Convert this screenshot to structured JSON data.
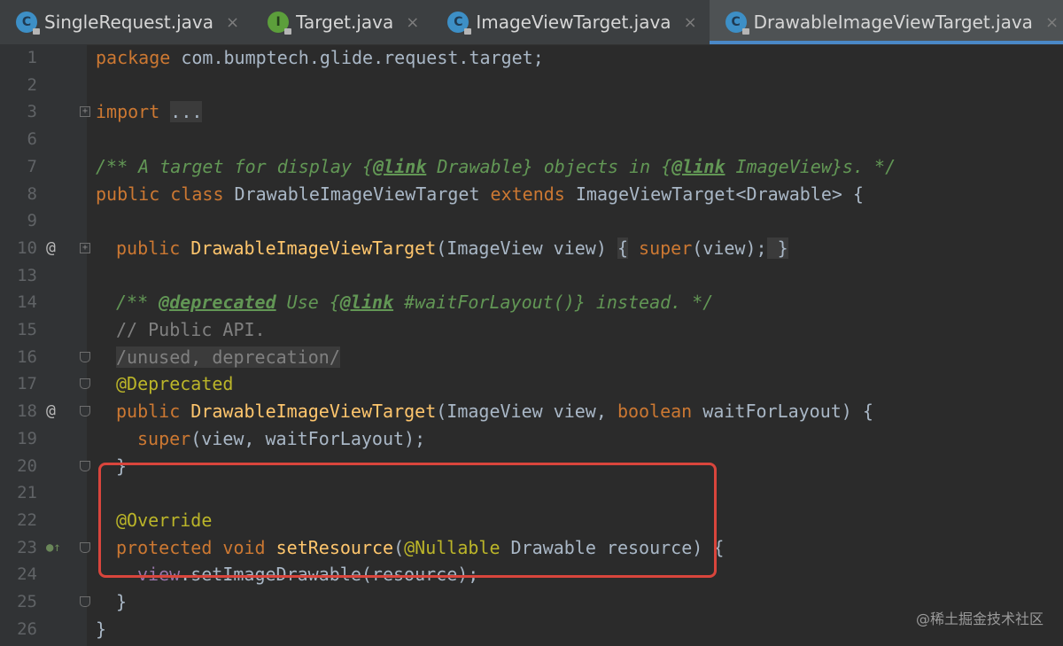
{
  "tabs": [
    {
      "label": "SingleRequest.java",
      "icon": "class-icon",
      "badge": "C"
    },
    {
      "label": "Target.java",
      "icon": "interface-icon",
      "badge": "I"
    },
    {
      "label": "ImageViewTarget.java",
      "icon": "class-icon",
      "badge": "C"
    },
    {
      "label": "DrawableImageViewTarget.java",
      "icon": "class-icon",
      "badge": "C",
      "active": true
    }
  ],
  "close_glyph": "×",
  "gutter": {
    "override_marker": "@",
    "implements_marker": "●↑"
  },
  "lines": {
    "l1": {
      "num": "1",
      "package_kw": "package",
      "package_name": " com.bumptech.glide.request.target;"
    },
    "l2": {
      "num": "2"
    },
    "l3": {
      "num": "3",
      "import_kw": "import",
      "folded": "..."
    },
    "l6": {
      "num": "6"
    },
    "l7": {
      "num": "7",
      "a": "/** A target for display {",
      "link1": "@link",
      "b": " Drawable} objects in {",
      "link2": "@link",
      "c": " ImageView}s. */"
    },
    "l8": {
      "num": "8",
      "kw1": "public class",
      "name": " DrawableImageViewTarget ",
      "kw2": "extends",
      "rest": " ImageViewTarget<Drawable> {"
    },
    "l9": {
      "num": "9"
    },
    "l10": {
      "num": "10",
      "kw": "public",
      "fn": " DrawableImageViewTarget",
      "params": "(ImageView view) ",
      "brace_open": "{",
      "super_kw": " super",
      "call": "(view);",
      "brace_close": " }"
    },
    "l13": {
      "num": "13"
    },
    "l14": {
      "num": "14",
      "a": "/** ",
      "tag": "@deprecated",
      "b": " Use {",
      "link": "@link",
      "c": " #waitForLayout()} instead. */"
    },
    "l15": {
      "num": "15",
      "text": "// Public API."
    },
    "l16": {
      "num": "16",
      "text": "/unused, deprecation/"
    },
    "l17": {
      "num": "17",
      "text": "@Deprecated"
    },
    "l18": {
      "num": "18",
      "kw": "public",
      "fn": " DrawableImageViewTarget",
      "a": "(ImageView view, ",
      "kw2": "boolean",
      "b": " waitForLayout) {"
    },
    "l19": {
      "num": "19",
      "kw": "super",
      "rest": "(view, waitForLayout);"
    },
    "l20": {
      "num": "20",
      "text": "}"
    },
    "l21": {
      "num": "21"
    },
    "l22": {
      "num": "22",
      "text": "@Override"
    },
    "l23": {
      "num": "23",
      "kw": "protected void",
      "fn": " setResource",
      "a": "(",
      "ann": "@Nullable",
      "b": " Drawable resource) {"
    },
    "l24": {
      "num": "24",
      "field": "view",
      "rest": ".setImageDrawable(resource);"
    },
    "l25": {
      "num": "25",
      "text": "}"
    },
    "l26": {
      "num": "26",
      "text": "}"
    }
  },
  "watermark": "@稀土掘金技术社区"
}
